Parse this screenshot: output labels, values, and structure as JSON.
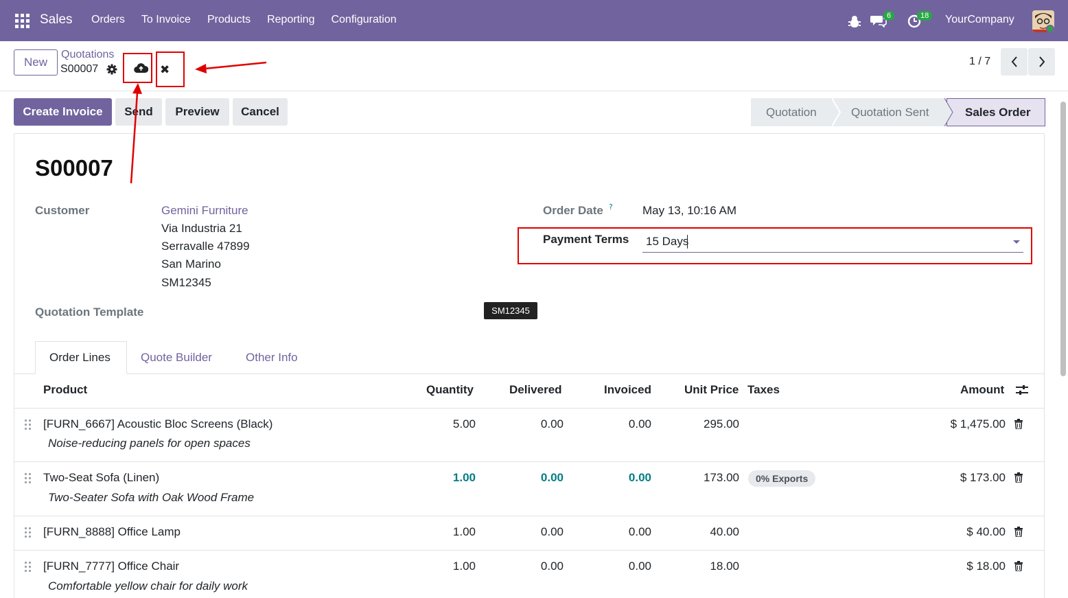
{
  "navbar": {
    "app_name": "Sales",
    "menu": [
      "Orders",
      "To Invoice",
      "Products",
      "Reporting",
      "Configuration"
    ],
    "messages_count": "6",
    "activities_count": "18",
    "company": "YourCompany",
    "bg_color": "#71639e"
  },
  "control_panel": {
    "new_label": "New",
    "breadcrumb_parent": "Quotations",
    "breadcrumb_current": "S00007",
    "pager": "1 / 7"
  },
  "actions": {
    "create_invoice": "Create Invoice",
    "send": "Send",
    "preview": "Preview",
    "cancel": "Cancel"
  },
  "status_stages": [
    "Quotation",
    "Quotation Sent",
    "Sales Order"
  ],
  "status_active": "Sales Order",
  "form": {
    "title": "S00007",
    "customer_label": "Customer",
    "customer_name": "Gemini Furniture",
    "customer_address": [
      "Via Industria 21",
      "Serravalle 47899",
      "San Marino",
      "SM12345"
    ],
    "quotation_template_label": "Quotation Template",
    "order_date_label": "Order Date",
    "order_date_help": "?",
    "order_date_value": "May 13, 10:16 AM",
    "payment_terms_label": "Payment Terms",
    "payment_terms_value": "15 Days",
    "tooltip": "SM12345"
  },
  "tabs": [
    "Order Lines",
    "Quote Builder",
    "Other Info"
  ],
  "table": {
    "headers": {
      "product": "Product",
      "quantity": "Quantity",
      "delivered": "Delivered",
      "invoiced": "Invoiced",
      "unit_price": "Unit Price",
      "taxes": "Taxes",
      "amount": "Amount"
    },
    "rows": [
      {
        "product": "[FURN_6667] Acoustic Bloc Screens (Black)",
        "description": "Noise-reducing panels for open spaces",
        "quantity": "5.00",
        "delivered": "0.00",
        "invoiced": "0.00",
        "unit_price": "295.00",
        "taxes": "",
        "amount": "$ 1,475.00"
      },
      {
        "product": "Two-Seat Sofa (Linen)",
        "description": "Two-Seater Sofa with Oak Wood Frame",
        "quantity": "1.00",
        "delivered": "0.00",
        "invoiced": "0.00",
        "unit_price": "173.00",
        "taxes": "0% Exports",
        "amount": "$ 173.00"
      },
      {
        "product": "[FURN_8888] Office Lamp",
        "description": "",
        "quantity": "1.00",
        "delivered": "0.00",
        "invoiced": "0.00",
        "unit_price": "40.00",
        "taxes": "",
        "amount": "$ 40.00"
      },
      {
        "product": "[FURN_7777] Office Chair",
        "description": "Comfortable yellow chair for daily work",
        "quantity": "1.00",
        "delivered": "0.00",
        "invoiced": "0.00",
        "unit_price": "18.00",
        "taxes": "",
        "amount": "$ 18.00"
      }
    ]
  },
  "colors": {
    "primary": "#71639e",
    "teal": "#017e84",
    "annotation_red": "#e00000"
  }
}
